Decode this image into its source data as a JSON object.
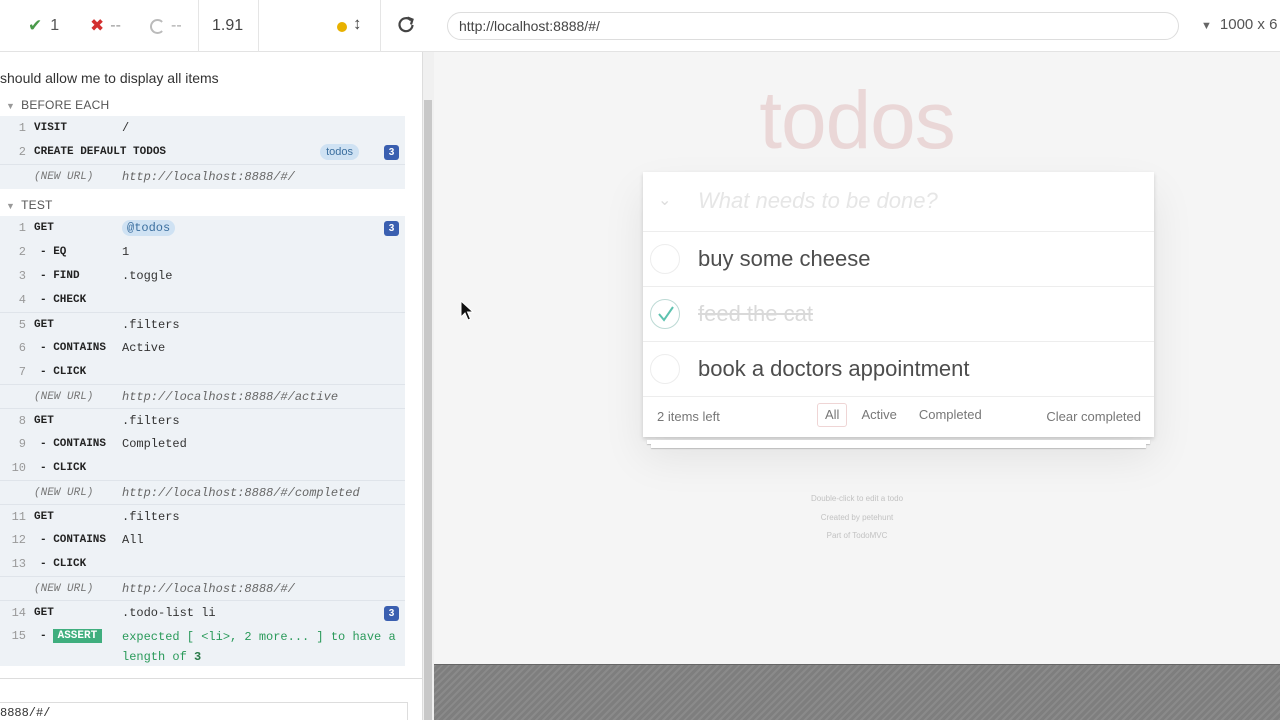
{
  "toolbar": {
    "passed_icon": "✔",
    "passed_count": "1",
    "failed_icon": "✖",
    "failed_count": "--",
    "pending_count": "--",
    "duration": "1.91",
    "running_color": "#e8b100",
    "url": "http://localhost:8888/#/",
    "viewport": "1000 x 6"
  },
  "log": {
    "test_title": "should allow me to display all items",
    "before_each_label": "BEFORE EACH",
    "before_each": [
      {
        "num": "1",
        "name": "VISIT",
        "msg": "/"
      },
      {
        "num": "2",
        "name": "CREATE DEFAULT TODOS",
        "tag": "todos",
        "badge": "3"
      },
      {
        "name": "(NEW URL)",
        "msg": "http://localhost:8888/#/"
      }
    ],
    "test_label": "TEST",
    "test": [
      {
        "num": "1",
        "name": "GET",
        "msg": "@todos",
        "badge": "3"
      },
      {
        "num": "2",
        "name": "- EQ",
        "msg": "1"
      },
      {
        "num": "3",
        "name": "- FIND",
        "msg": ".toggle"
      },
      {
        "num": "4",
        "name": "- CHECK",
        "msg": ""
      },
      {
        "num": "5",
        "name": "GET",
        "msg": ".filters"
      },
      {
        "num": "6",
        "name": "- CONTAINS",
        "msg": "Active"
      },
      {
        "num": "7",
        "name": "- CLICK",
        "msg": ""
      },
      {
        "name": "(NEW URL)",
        "msg": "http://localhost:8888/#/active"
      },
      {
        "num": "8",
        "name": "GET",
        "msg": ".filters"
      },
      {
        "num": "9",
        "name": "- CONTAINS",
        "msg": "Completed"
      },
      {
        "num": "10",
        "name": "- CLICK",
        "msg": ""
      },
      {
        "name": "(NEW URL)",
        "msg": "http://localhost:8888/#/completed"
      },
      {
        "num": "11",
        "name": "GET",
        "msg": ".filters"
      },
      {
        "num": "12",
        "name": "- CONTAINS",
        "msg": "All"
      },
      {
        "num": "13",
        "name": "- CLICK",
        "msg": ""
      },
      {
        "name": "(NEW URL)",
        "msg": "http://localhost:8888/#/"
      },
      {
        "num": "14",
        "name": "GET",
        "msg": ".todo-list li",
        "badge": "3"
      },
      {
        "num": "15",
        "name": "-",
        "assert_label": "ASSERT",
        "msg_a": "expected [ <li>, 2 more... ] to have a length of",
        "msg_b": "3"
      }
    ],
    "bottom_url": "8888/#/"
  },
  "app": {
    "title": "todos",
    "placeholder": "What needs to be done?",
    "items": [
      {
        "label": "buy some cheese",
        "completed": false
      },
      {
        "label": "feed the cat",
        "completed": true
      },
      {
        "label": "book a doctors appointment",
        "completed": false
      }
    ],
    "count": "2 items left",
    "filters": [
      "All",
      "Active",
      "Completed"
    ],
    "selected_filter": "All",
    "clear": "Clear completed",
    "info": [
      "Double-click to edit a todo",
      "Created by petehunt",
      "Part of TodoMVC"
    ]
  }
}
